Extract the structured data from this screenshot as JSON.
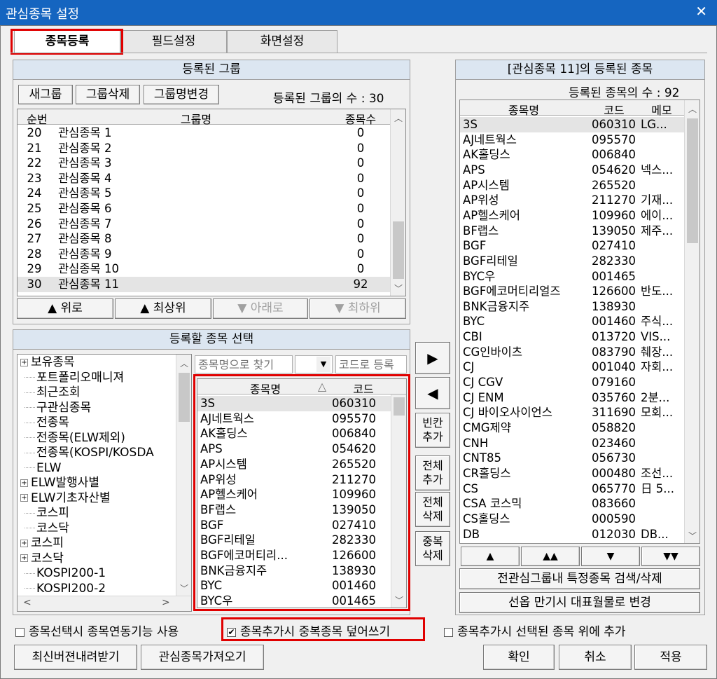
{
  "window": {
    "title": "관심종목 설정",
    "close": "✕"
  },
  "tabs": [
    "종목등록",
    "필드설정",
    "화면설정"
  ],
  "groups": {
    "header": "등록된 그룹",
    "new_btn": "새그룹",
    "delete_btn": "그룹삭제",
    "rename_btn": "그룹명변경",
    "count_label": "등록된 그룹의 수 : 30",
    "cols": [
      "순번",
      "그룹명",
      "종목수"
    ],
    "rows": [
      [
        "20",
        "관심종목 1",
        "0"
      ],
      [
        "21",
        "관심종목 2",
        "0"
      ],
      [
        "22",
        "관심종목 3",
        "0"
      ],
      [
        "23",
        "관심종목 4",
        "0"
      ],
      [
        "24",
        "관심종목 5",
        "0"
      ],
      [
        "25",
        "관심종목 6",
        "0"
      ],
      [
        "26",
        "관심종목 7",
        "0"
      ],
      [
        "27",
        "관심종목 8",
        "0"
      ],
      [
        "28",
        "관심종목 9",
        "0"
      ],
      [
        "29",
        "관심종목 10",
        "0"
      ],
      [
        "30",
        "관심종목 11",
        "92"
      ]
    ],
    "up": "▲ 위로",
    "top": "▲ 최상위",
    "down": "▼ 아래로",
    "bottom": "▼ 최하위"
  },
  "select": {
    "header": "등록할 종목 선택",
    "tree": [
      {
        "t": "보유종목",
        "plus": true
      },
      {
        "t": "포트폴리오매니져"
      },
      {
        "t": "최근조회"
      },
      {
        "t": "구관심종목"
      },
      {
        "t": "전종목"
      },
      {
        "t": "전종목(ELW제외)"
      },
      {
        "t": "전종목(KOSPI/KOSDA"
      },
      {
        "t": "ELW"
      },
      {
        "t": "ELW발행사별",
        "plus": true
      },
      {
        "t": "ELW기초자산별",
        "plus": true
      },
      {
        "t": "코스피"
      },
      {
        "t": "코스닥"
      },
      {
        "t": "코스피",
        "plus": true
      },
      {
        "t": "코스닥",
        "plus": true
      },
      {
        "t": "KOSPI200-1"
      },
      {
        "t": "KOSPI200-2"
      }
    ],
    "search_name_placeholder": "종목명으로 찾기",
    "search_code_placeholder": "코드로 등록",
    "cols": [
      "종목명",
      "코드"
    ],
    "sort_arrow": "△",
    "rows": [
      [
        "3S",
        "060310"
      ],
      [
        "AJ네트웍스",
        "095570"
      ],
      [
        "AK홀딩스",
        "006840"
      ],
      [
        "APS",
        "054620"
      ],
      [
        "AP시스템",
        "265520"
      ],
      [
        "AP위성",
        "211270"
      ],
      [
        "AP헬스케어",
        "109960"
      ],
      [
        "BF랩스",
        "139050"
      ],
      [
        "BGF",
        "027410"
      ],
      [
        "BGF리테일",
        "282330"
      ],
      [
        "BGF에코머티리...",
        "126600"
      ],
      [
        "BNK금융지주",
        "138930"
      ],
      [
        "BYC",
        "001460"
      ],
      [
        "BYC우",
        "001465"
      ]
    ]
  },
  "mid_buttons": {
    "add": "▶",
    "remove": "◀",
    "blank": [
      "빈칸",
      "추가"
    ],
    "add_all": [
      "전체",
      "추가"
    ],
    "del_all": [
      "전체",
      "삭제"
    ],
    "del_dup": [
      "중복",
      "삭제"
    ]
  },
  "registered": {
    "header": "[관심종목 11]의 등록된 종목",
    "count_label": "등록된 종목의 수 : 92",
    "cols": [
      "종목명",
      "코드",
      "메모"
    ],
    "rows": [
      [
        "3S",
        "060310",
        "LG..."
      ],
      [
        "AJ네트웍스",
        "095570",
        ""
      ],
      [
        "AK홀딩스",
        "006840",
        ""
      ],
      [
        "APS",
        "054620",
        "넥스..."
      ],
      [
        "AP시스템",
        "265520",
        ""
      ],
      [
        "AP위성",
        "211270",
        "기재..."
      ],
      [
        "AP헬스케어",
        "109960",
        "에이..."
      ],
      [
        "BF랩스",
        "139050",
        "제주..."
      ],
      [
        "BGF",
        "027410",
        ""
      ],
      [
        "BGF리테일",
        "282330",
        ""
      ],
      [
        "BYC우",
        "001465",
        ""
      ],
      [
        "BGF에코머티리얼즈",
        "126600",
        "반도..."
      ],
      [
        "BNK금융지주",
        "138930",
        ""
      ],
      [
        "BYC",
        "001460",
        "주식..."
      ],
      [
        "CBI",
        "013720",
        "VIS..."
      ],
      [
        "CG인바이츠",
        "083790",
        "췌장..."
      ],
      [
        "CJ",
        "001040",
        "자회..."
      ],
      [
        "CJ CGV",
        "079160",
        ""
      ],
      [
        "CJ ENM",
        "035760",
        "2분..."
      ],
      [
        "CJ 바이오사이언스",
        "311690",
        "모회..."
      ],
      [
        "CMG제약",
        "058820",
        ""
      ],
      [
        "CNH",
        "023460",
        ""
      ],
      [
        "CNT85",
        "056730",
        ""
      ],
      [
        "CR홀딩스",
        "000480",
        "조선..."
      ],
      [
        "CS",
        "065770",
        "日 5..."
      ],
      [
        "CSA 코스믹",
        "083660",
        ""
      ],
      [
        "CS홀딩스",
        "000590",
        ""
      ],
      [
        "DB",
        "012030",
        "DB..."
      ]
    ],
    "move": [
      "▲",
      "▲▲",
      "▼",
      "▼▼"
    ],
    "search_btn": "전관심그룹내 특정종목 검색/삭제",
    "futures_btn": "선옵 만기시 대표월물로 변경"
  },
  "options": {
    "opt1": "종목선택시 종목연동기능 사용",
    "opt2": "종목추가시 중복종목 덮어쓰기",
    "opt3": "종목추가시 선택된 종목 위에 추가",
    "check": "✔"
  },
  "footer": {
    "download": "최신버젼내려받기",
    "import": "관심종목가져오기",
    "ok": "확인",
    "cancel": "취소",
    "apply": "적용"
  }
}
